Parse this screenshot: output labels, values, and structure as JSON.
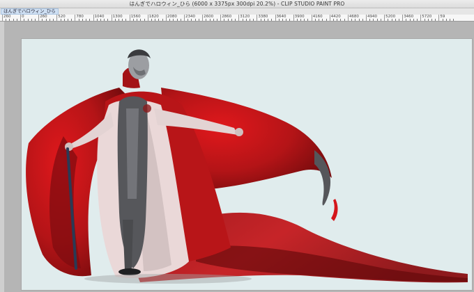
{
  "window": {
    "title": "はんぎでハロウィン_ひら (6000 x 3375px 300dpi 20.2%)  - CLIP STUDIO PAINT PRO"
  },
  "tabs": [
    {
      "label": "はんぎでハロウィン_ひら",
      "active": true
    }
  ],
  "ruler": {
    "labels": [
      "260",
      "0",
      "260",
      "520",
      "780",
      "1040",
      "1300",
      "1560",
      "1820",
      "2080",
      "2340",
      "2600",
      "2860",
      "3120",
      "3380",
      "3640",
      "3900",
      "4160",
      "4420",
      "4680",
      "4940",
      "5200",
      "3460",
      "5720",
      "59"
    ]
  },
  "colors": {
    "canvas_background": "#e0eced",
    "cape_red": "#c0161a",
    "cape_dark": "#6e0a0c",
    "suit_gray": "#4a4b4e",
    "coat_white": "#ead8d8",
    "cane_navy": "#2a3a55"
  },
  "icons": {
    "drawing": "painting-of-caped-man-with-cane"
  }
}
